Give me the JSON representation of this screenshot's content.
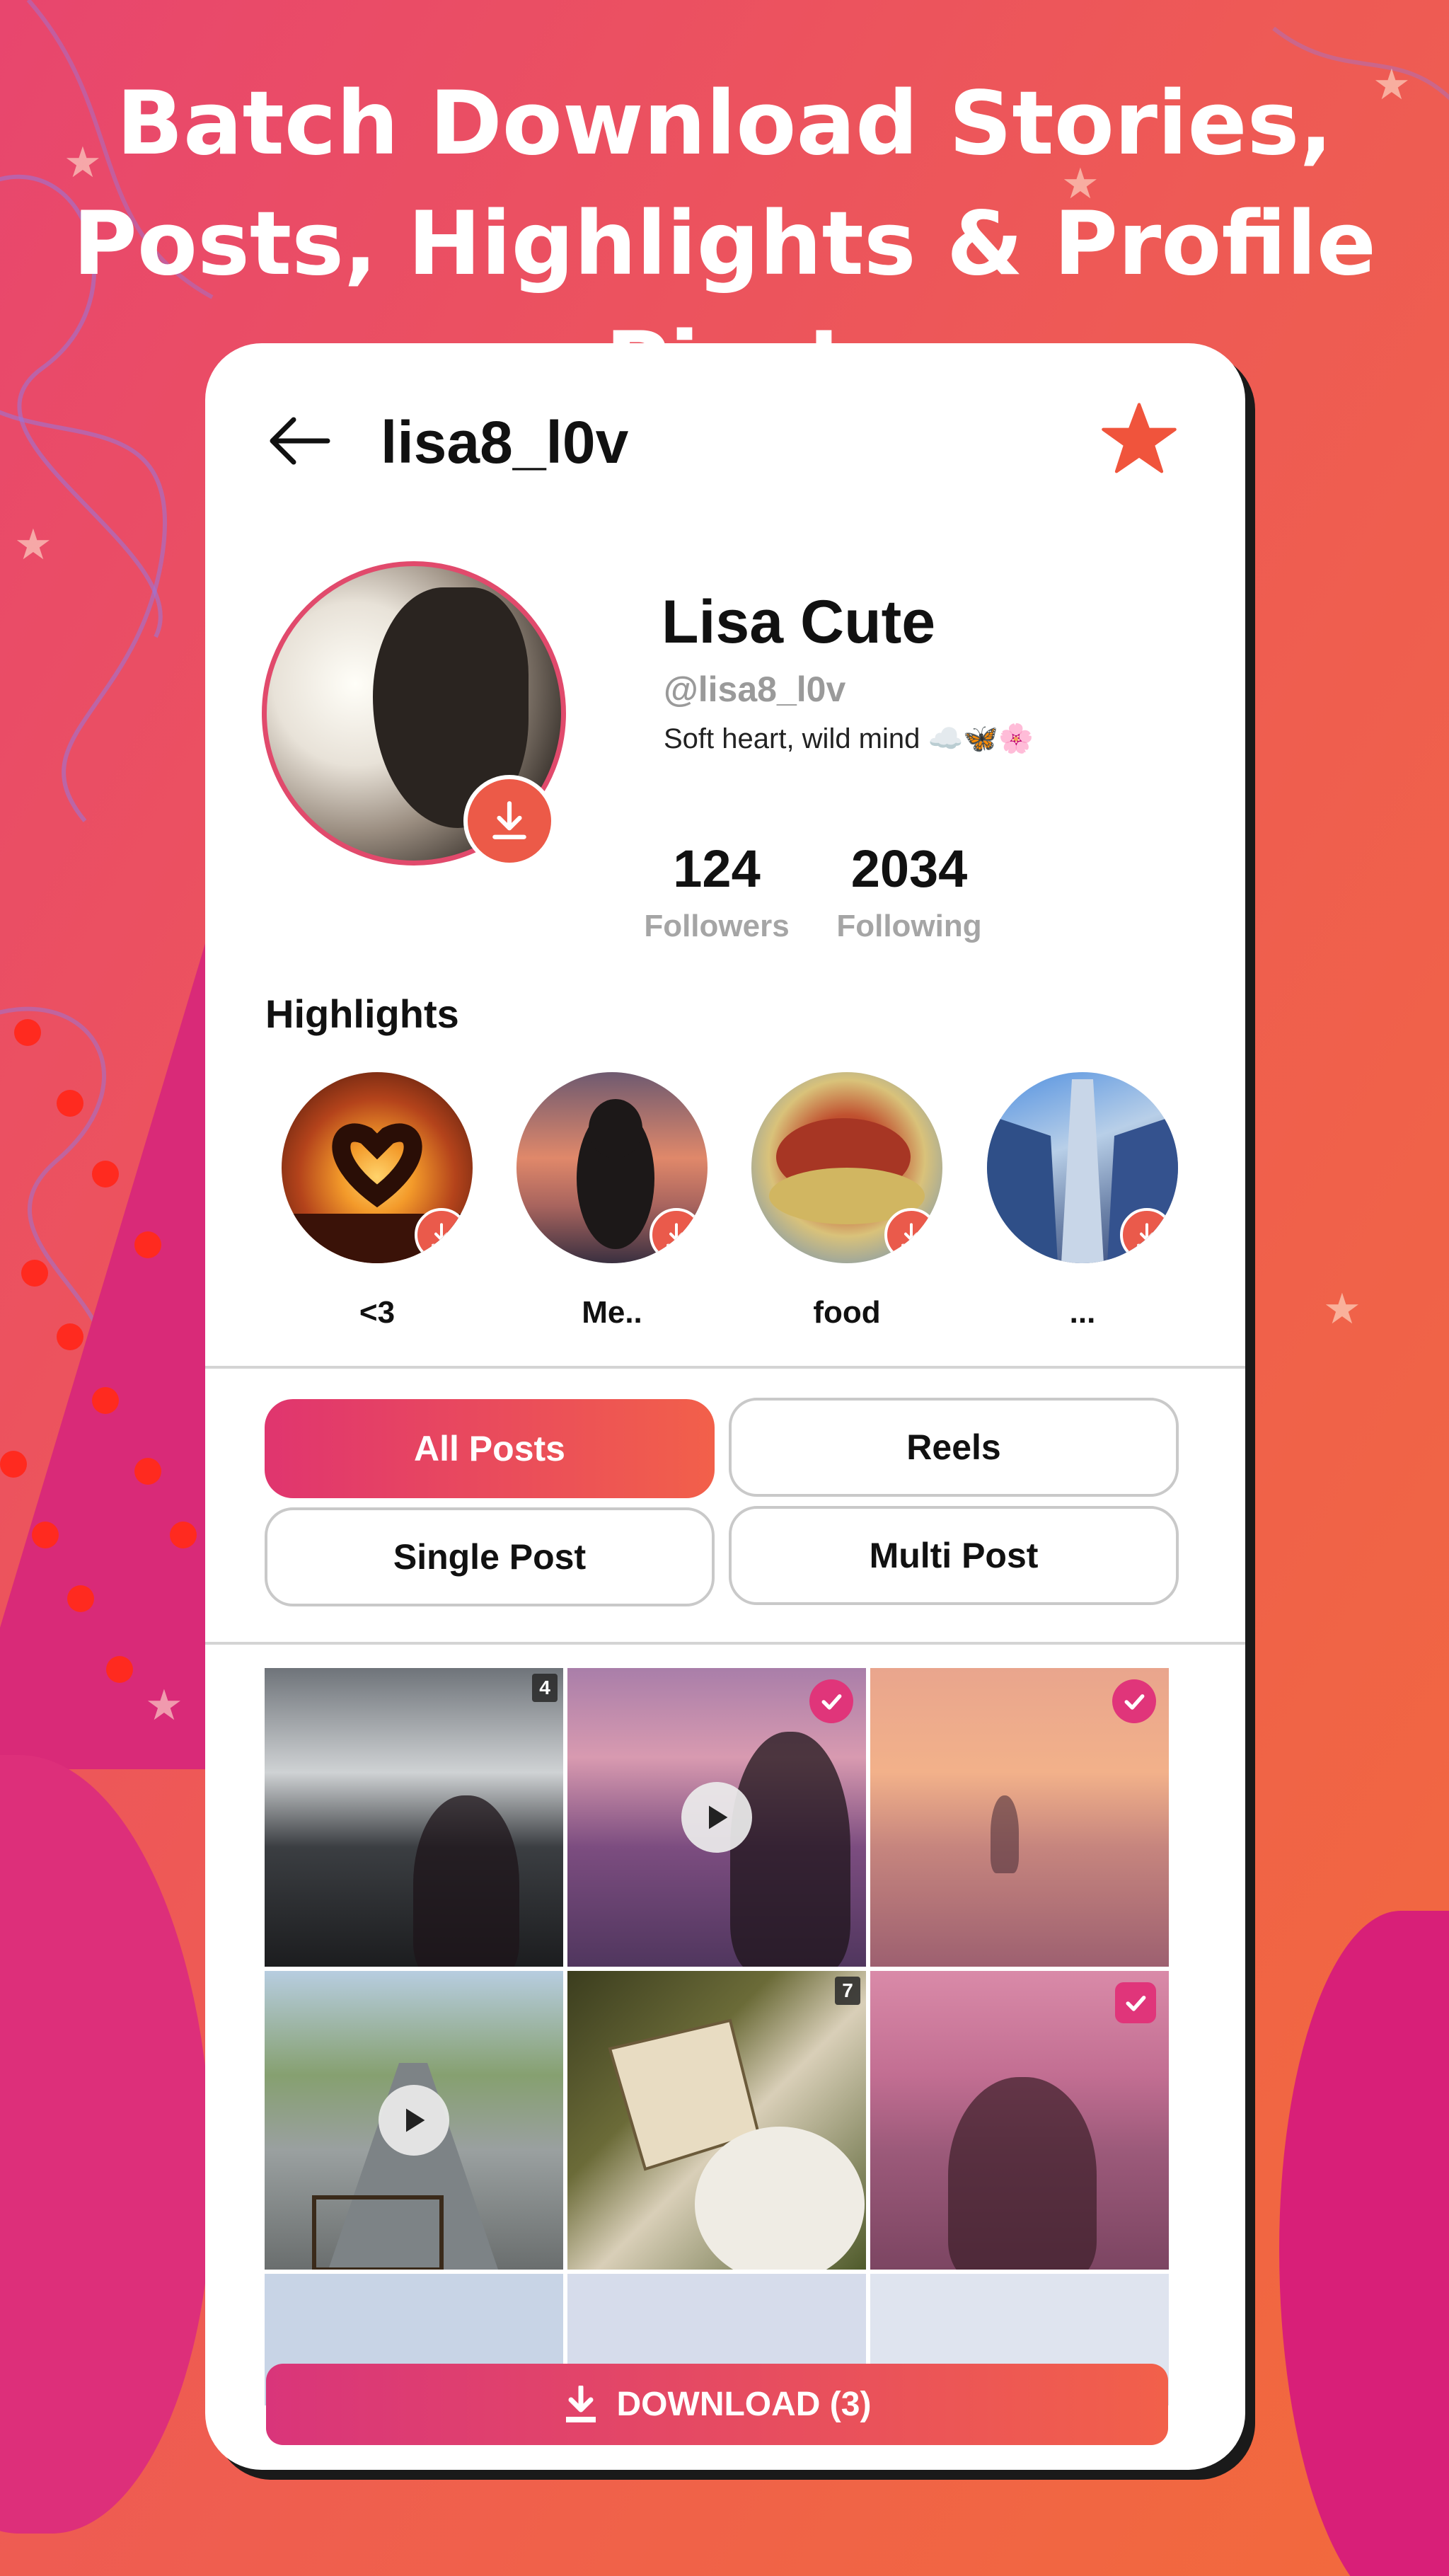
{
  "headline": {
    "line1": "Batch Download Stories,",
    "line2": "Posts, Highlights & Profile Pics!"
  },
  "profile_header": {
    "username": "lisa8_l0v"
  },
  "profile": {
    "display_name": "Lisa Cute",
    "handle": "@lisa8_l0v",
    "bio": "Soft heart, wild mind ☁️🦋🌸",
    "followers_count": "124",
    "followers_label": "Followers",
    "following_count": "2034",
    "following_label": "Following"
  },
  "highlights": {
    "title": "Highlights",
    "items": [
      {
        "label": "<3"
      },
      {
        "label": "Me.."
      },
      {
        "label": "food"
      },
      {
        "label": "..."
      }
    ]
  },
  "tabs": {
    "all_posts": "All Posts",
    "reels": "Reels",
    "single_post": "Single Post",
    "multi_post": "Multi Post",
    "active": "All Posts"
  },
  "grid": {
    "posts": [
      {
        "badge": "4",
        "type": "multi",
        "selected": false
      },
      {
        "badge": "",
        "type": "video",
        "selected": true
      },
      {
        "badge": "",
        "type": "single",
        "selected": true
      },
      {
        "badge": "",
        "type": "video",
        "selected": false
      },
      {
        "badge": "7",
        "type": "multi",
        "selected": false
      },
      {
        "badge": "",
        "type": "single",
        "selected": true
      }
    ]
  },
  "download_button": {
    "label": "DOWNLOAD (3)"
  },
  "colors": {
    "accent_start": "#e0356f",
    "accent_end": "#f2604a",
    "star": "#f0543c",
    "check": "#e0357a"
  }
}
